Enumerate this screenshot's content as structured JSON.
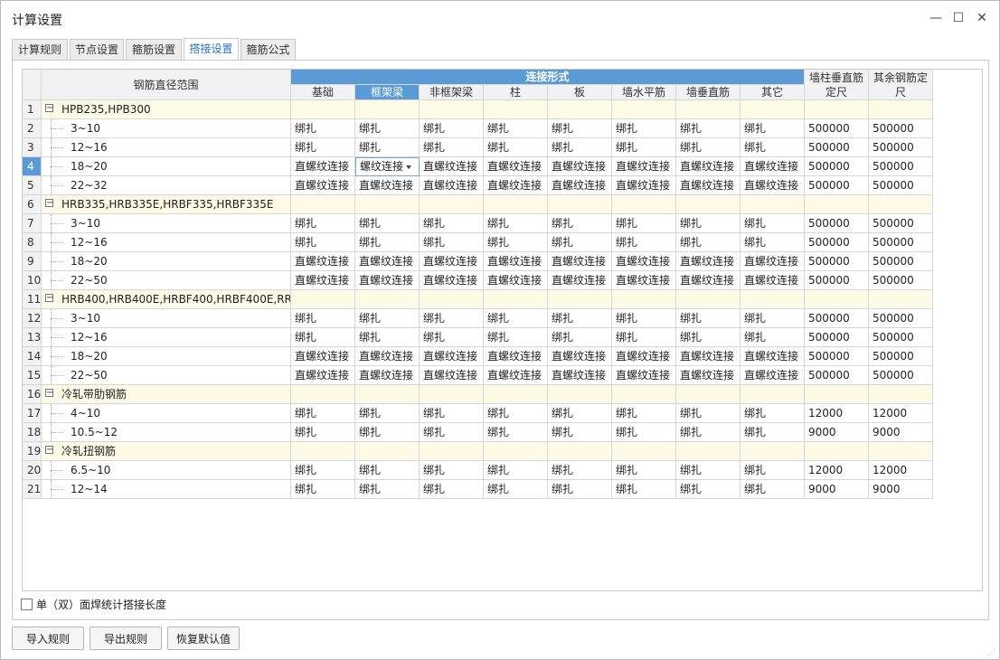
{
  "window": {
    "title": "计算设置",
    "minimize_glyph": "—",
    "maximize_glyph": "☐",
    "close_glyph": "✕"
  },
  "tabs": [
    {
      "label": "计算规则",
      "active": false
    },
    {
      "label": "节点设置",
      "active": false
    },
    {
      "label": "箍筋设置",
      "active": false
    },
    {
      "label": "搭接设置",
      "active": true
    },
    {
      "label": "箍筋公式",
      "active": false
    }
  ],
  "table": {
    "range_header": "钢筋直径范围",
    "group_header": "连接形式",
    "columns": [
      "基础",
      "框架梁",
      "非框架梁",
      "柱",
      "板",
      "墙水平筋",
      "墙垂直筋",
      "其它"
    ],
    "selected_column": "框架梁",
    "extra_headers": [
      "墙柱垂直筋\n定尺",
      "其余钢筋定\n尺"
    ],
    "selected_row": "4",
    "rows": [
      {
        "num": "1",
        "group": true,
        "name": "HPB235,HPB300"
      },
      {
        "num": "2",
        "name": "3~10",
        "values": [
          "绑扎",
          "绑扎",
          "绑扎",
          "绑扎",
          "绑扎",
          "绑扎",
          "绑扎",
          "绑扎"
        ],
        "len1": "500000",
        "len2": "500000"
      },
      {
        "num": "3",
        "name": "12~16",
        "values": [
          "绑扎",
          "绑扎",
          "绑扎",
          "绑扎",
          "绑扎",
          "绑扎",
          "绑扎",
          "绑扎"
        ],
        "len1": "500000",
        "len2": "500000"
      },
      {
        "num": "4",
        "name": "18~20",
        "values": [
          "直螺纹连接",
          "螺纹连接",
          "直螺纹连接",
          "直螺纹连接",
          "直螺纹连接",
          "直螺纹连接",
          "直螺纹连接",
          "直螺纹连接"
        ],
        "len1": "500000",
        "len2": "500000",
        "edit_index": 1
      },
      {
        "num": "5",
        "name": "22~32",
        "values": [
          "直螺纹连接",
          "直螺纹连接",
          "直螺纹连接",
          "直螺纹连接",
          "直螺纹连接",
          "直螺纹连接",
          "直螺纹连接",
          "直螺纹连接"
        ],
        "len1": "500000",
        "len2": "500000"
      },
      {
        "num": "6",
        "group": true,
        "name": "HRB335,HRB335E,HRBF335,HRBF335E"
      },
      {
        "num": "7",
        "name": "3~10",
        "values": [
          "绑扎",
          "绑扎",
          "绑扎",
          "绑扎",
          "绑扎",
          "绑扎",
          "绑扎",
          "绑扎"
        ],
        "len1": "500000",
        "len2": "500000"
      },
      {
        "num": "8",
        "name": "12~16",
        "values": [
          "绑扎",
          "绑扎",
          "绑扎",
          "绑扎",
          "绑扎",
          "绑扎",
          "绑扎",
          "绑扎"
        ],
        "len1": "500000",
        "len2": "500000"
      },
      {
        "num": "9",
        "name": "18~20",
        "values": [
          "直螺纹连接",
          "直螺纹连接",
          "直螺纹连接",
          "直螺纹连接",
          "直螺纹连接",
          "直螺纹连接",
          "直螺纹连接",
          "直螺纹连接"
        ],
        "len1": "500000",
        "len2": "500000"
      },
      {
        "num": "10",
        "name": "22~50",
        "values": [
          "直螺纹连接",
          "直螺纹连接",
          "直螺纹连接",
          "直螺纹连接",
          "直螺纹连接",
          "直螺纹连接",
          "直螺纹连接",
          "直螺纹连接"
        ],
        "len1": "500000",
        "len2": "500000"
      },
      {
        "num": "11",
        "group": true,
        "name": "HRB400,HRB400E,HRBF400,HRBF400E,RR..."
      },
      {
        "num": "12",
        "name": "3~10",
        "values": [
          "绑扎",
          "绑扎",
          "绑扎",
          "绑扎",
          "绑扎",
          "绑扎",
          "绑扎",
          "绑扎"
        ],
        "len1": "500000",
        "len2": "500000"
      },
      {
        "num": "13",
        "name": "12~16",
        "values": [
          "绑扎",
          "绑扎",
          "绑扎",
          "绑扎",
          "绑扎",
          "绑扎",
          "绑扎",
          "绑扎"
        ],
        "len1": "500000",
        "len2": "500000"
      },
      {
        "num": "14",
        "name": "18~20",
        "values": [
          "直螺纹连接",
          "直螺纹连接",
          "直螺纹连接",
          "直螺纹连接",
          "直螺纹连接",
          "直螺纹连接",
          "直螺纹连接",
          "直螺纹连接"
        ],
        "len1": "500000",
        "len2": "500000"
      },
      {
        "num": "15",
        "name": "22~50",
        "values": [
          "直螺纹连接",
          "直螺纹连接",
          "直螺纹连接",
          "直螺纹连接",
          "直螺纹连接",
          "直螺纹连接",
          "直螺纹连接",
          "直螺纹连接"
        ],
        "len1": "500000",
        "len2": "500000"
      },
      {
        "num": "16",
        "group": true,
        "name": "冷轧带肋钢筋"
      },
      {
        "num": "17",
        "name": "4~10",
        "values": [
          "绑扎",
          "绑扎",
          "绑扎",
          "绑扎",
          "绑扎",
          "绑扎",
          "绑扎",
          "绑扎"
        ],
        "len1": "12000",
        "len2": "12000"
      },
      {
        "num": "18",
        "name": "10.5~12",
        "values": [
          "绑扎",
          "绑扎",
          "绑扎",
          "绑扎",
          "绑扎",
          "绑扎",
          "绑扎",
          "绑扎"
        ],
        "len1": "9000",
        "len2": "9000"
      },
      {
        "num": "19",
        "group": true,
        "name": "冷轧扭钢筋"
      },
      {
        "num": "20",
        "name": "6.5~10",
        "values": [
          "绑扎",
          "绑扎",
          "绑扎",
          "绑扎",
          "绑扎",
          "绑扎",
          "绑扎",
          "绑扎"
        ],
        "len1": "12000",
        "len2": "12000"
      },
      {
        "num": "21",
        "name": "12~14",
        "values": [
          "绑扎",
          "绑扎",
          "绑扎",
          "绑扎",
          "绑扎",
          "绑扎",
          "绑扎",
          "绑扎"
        ],
        "len1": "9000",
        "len2": "9000"
      }
    ]
  },
  "checkbox": {
    "label": "单（双）面焊统计搭接长度",
    "checked": false
  },
  "buttons": {
    "import": "导入规则",
    "export": "导出规则",
    "restore": "恢复默认值"
  },
  "colors": {
    "header_blue": "#5b9bd5",
    "group_row": "#fdfbe6",
    "active_tab_text": "#2b73c4"
  }
}
